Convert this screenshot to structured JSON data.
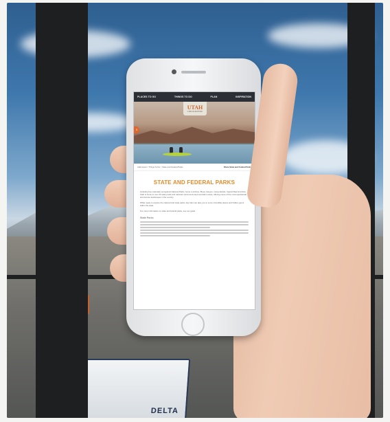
{
  "phone_screen": {
    "nav": [
      "PLACES TO GO",
      "THINGS TO DO",
      "PLAN",
      "INSPIRATION"
    ],
    "logo": {
      "word": "UTAH",
      "sub": "LIFE ELEVATED"
    },
    "side_tab": "3",
    "breadcrumb_left": "Utah.travel > Things To Do > State and Federal Parks",
    "breadcrumb_right": "Share State and Federal Parks",
    "title": "STATE AND FEDERAL PARKS",
    "section_heading": "State Parks",
    "paragraphs": [
      "Including five nationally recognized National Parks, home to Arches, Bryce Canyon, Canyonlands, Capitol Reef and Zion, Utah is home to over 40 state parks and national monuments and recreation areas, offering some of the most spectacular and diverse landscapes in the country.",
      "While ready to explore the national and state parks, day trips can take you to some incredible places and hidden gems within the state.",
      "For more information on state and federal parks, see our guide."
    ]
  },
  "truck": {
    "label": "DELTA"
  }
}
